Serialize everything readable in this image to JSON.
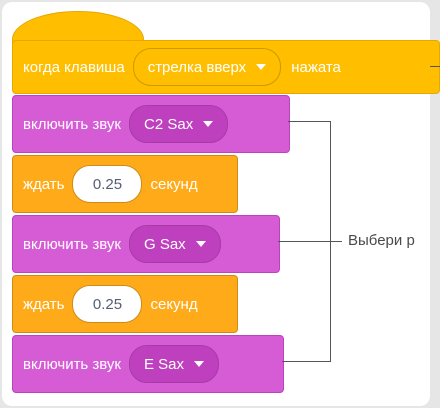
{
  "hat_block": {
    "label": "когда клавиша",
    "key_option": "стрелка вверх",
    "suffix": "нажата"
  },
  "blocks": [
    {
      "label": "включить звук",
      "sound": "C2 Sax"
    },
    {
      "label": "ждать",
      "value": "0.25",
      "unit": "секунд"
    },
    {
      "label": "включить звук",
      "sound": "G Sax"
    },
    {
      "label": "ждать",
      "value": "0.25",
      "unit": "секунд"
    },
    {
      "label": "включить звук",
      "sound": "E Sax"
    }
  ],
  "callout": "Выбери р",
  "colors": {
    "events": "#ffbf00",
    "sound": "#d65cd6",
    "control": "#ffab19",
    "background": "#e6e6e6"
  }
}
